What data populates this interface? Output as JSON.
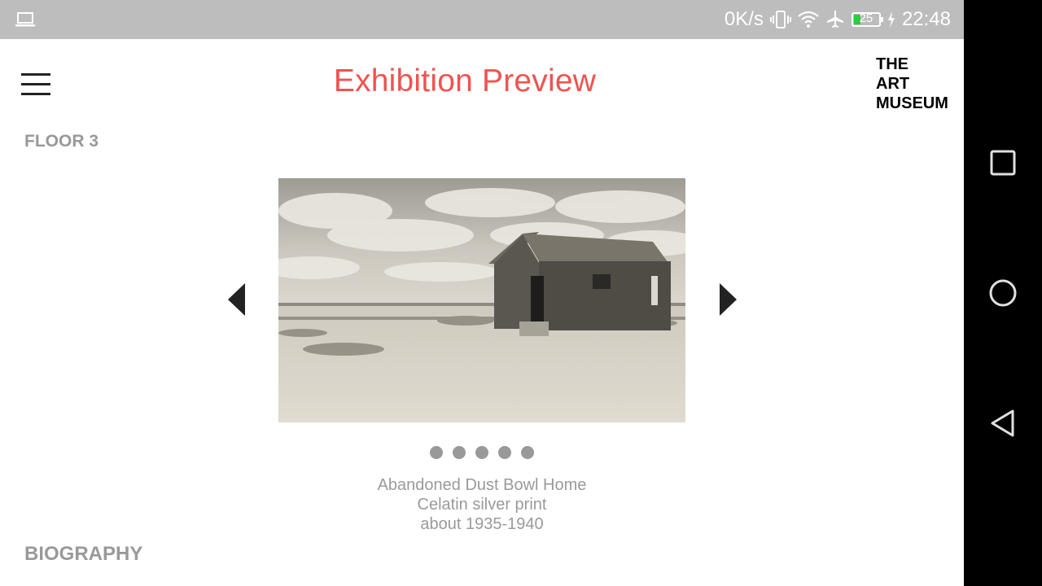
{
  "status_bar": {
    "net_speed": "0K/s",
    "battery_level": "25",
    "time": "22:48",
    "icons": [
      "laptop-icon",
      "vibrate-icon",
      "wifi-icon",
      "airplane-icon",
      "battery-icon",
      "charging-icon"
    ]
  },
  "header": {
    "title": "Exhibition Preview",
    "logo_lines": [
      "THE",
      "ART",
      "MUSEUM"
    ],
    "title_color": "#ef5350"
  },
  "floor_label": "FLOOR 3",
  "carousel": {
    "slide_count": 5,
    "current_index": 0,
    "artwork": {
      "title": "Abandoned Dust Bowl Home",
      "medium": "Celatin silver print",
      "date": "about 1935-1940"
    }
  },
  "biography_label": "BIOGRAPHY",
  "nav_bar": {
    "icons": [
      "recent-apps-icon",
      "home-icon",
      "back-icon"
    ]
  }
}
